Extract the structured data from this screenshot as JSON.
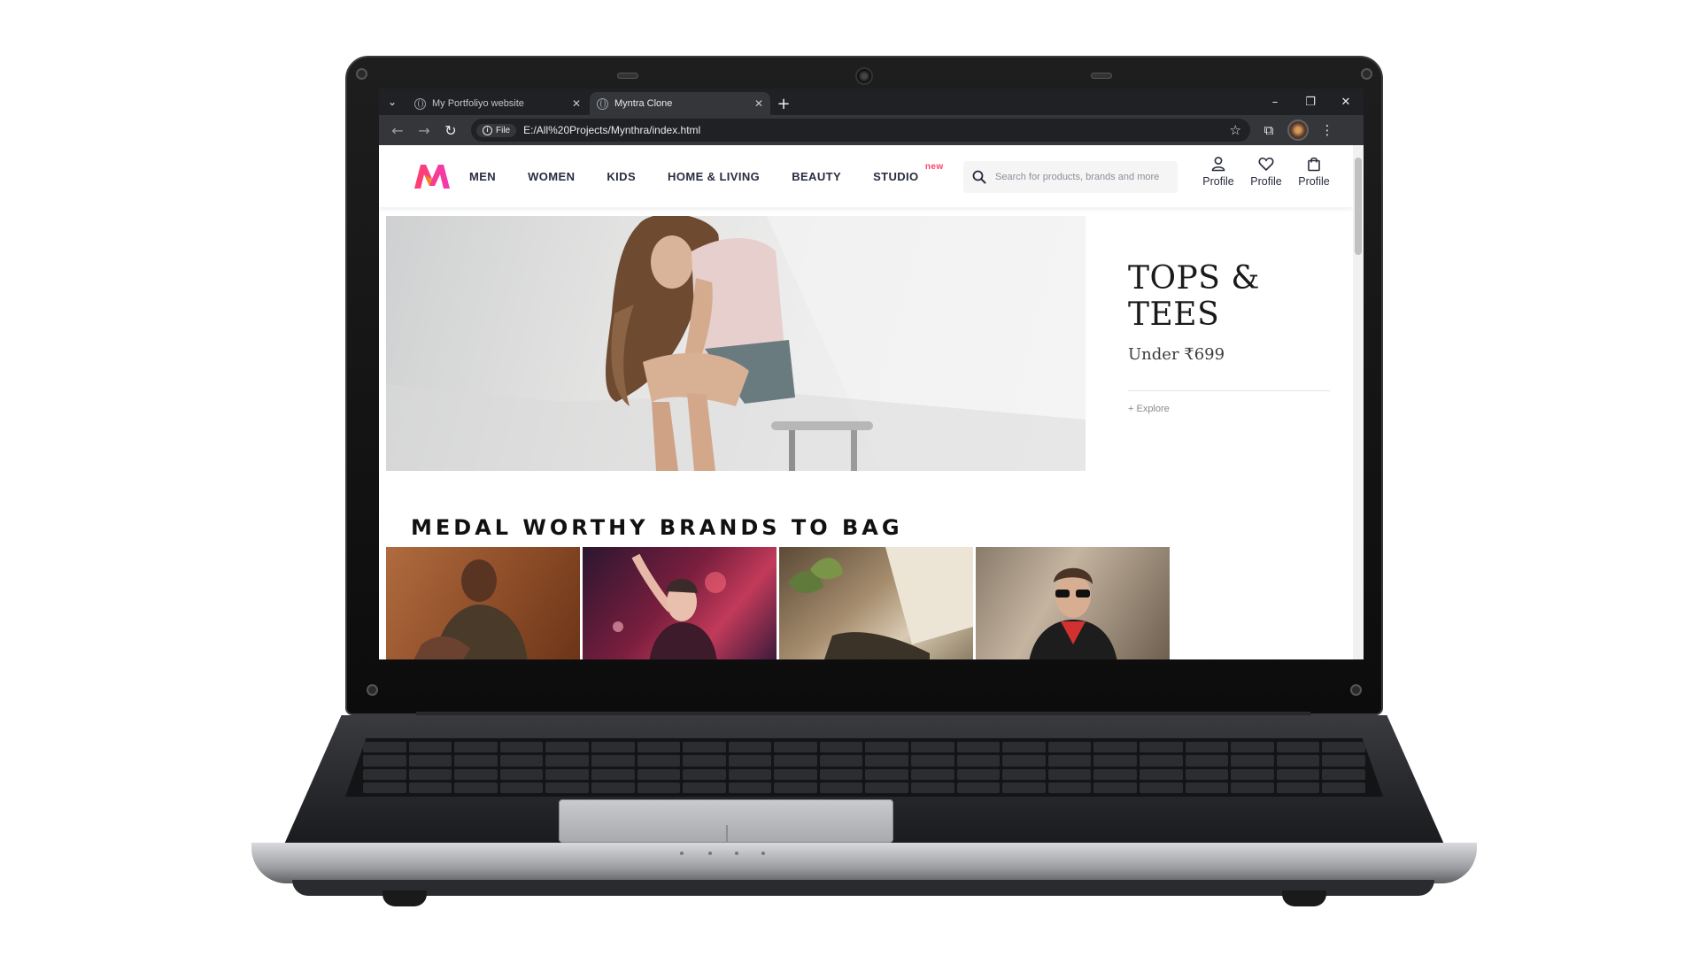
{
  "browser": {
    "tabs": [
      {
        "title": "My Portfoliyo website",
        "active": false
      },
      {
        "title": "Myntra Clone",
        "active": true
      }
    ],
    "address": {
      "chip_label": "File",
      "url": "E:/All%20Projects/Mynthra/index.html"
    },
    "icons": {
      "tab_dropdown": "⌄",
      "close": "✕",
      "new_tab": "+",
      "minimize": "–",
      "restore": "❐",
      "window_close": "✕",
      "back": "←",
      "forward": "→",
      "reload": "↻",
      "info": "i",
      "star": "☆",
      "extensions": "⧉",
      "menu": "⋮"
    }
  },
  "site": {
    "nav": {
      "items": [
        "MEN",
        "WOMEN",
        "KIDS",
        "HOME & LIVING",
        "BEAUTY",
        "STUDIO"
      ],
      "studio_badge": "new"
    },
    "search": {
      "placeholder": "Search for products, brands and more"
    },
    "actions": [
      "Profile",
      "Profile",
      "Profile"
    ],
    "hero": {
      "title": "TOPS & TEES",
      "subtitle": "Under ₹699",
      "link": "+ Explore"
    },
    "brands_section": {
      "title": "MEDAL WORTHY BRANDS TO BAG"
    },
    "brand_cards": [
      "brand-card-1",
      "brand-card-2",
      "brand-card-3",
      "brand-card-4"
    ],
    "colors": {
      "logo_start": "#ff3f6c",
      "logo_end": "#f13ab1",
      "text_dark": "#282c3f",
      "badge": "#ff3f6c"
    }
  }
}
